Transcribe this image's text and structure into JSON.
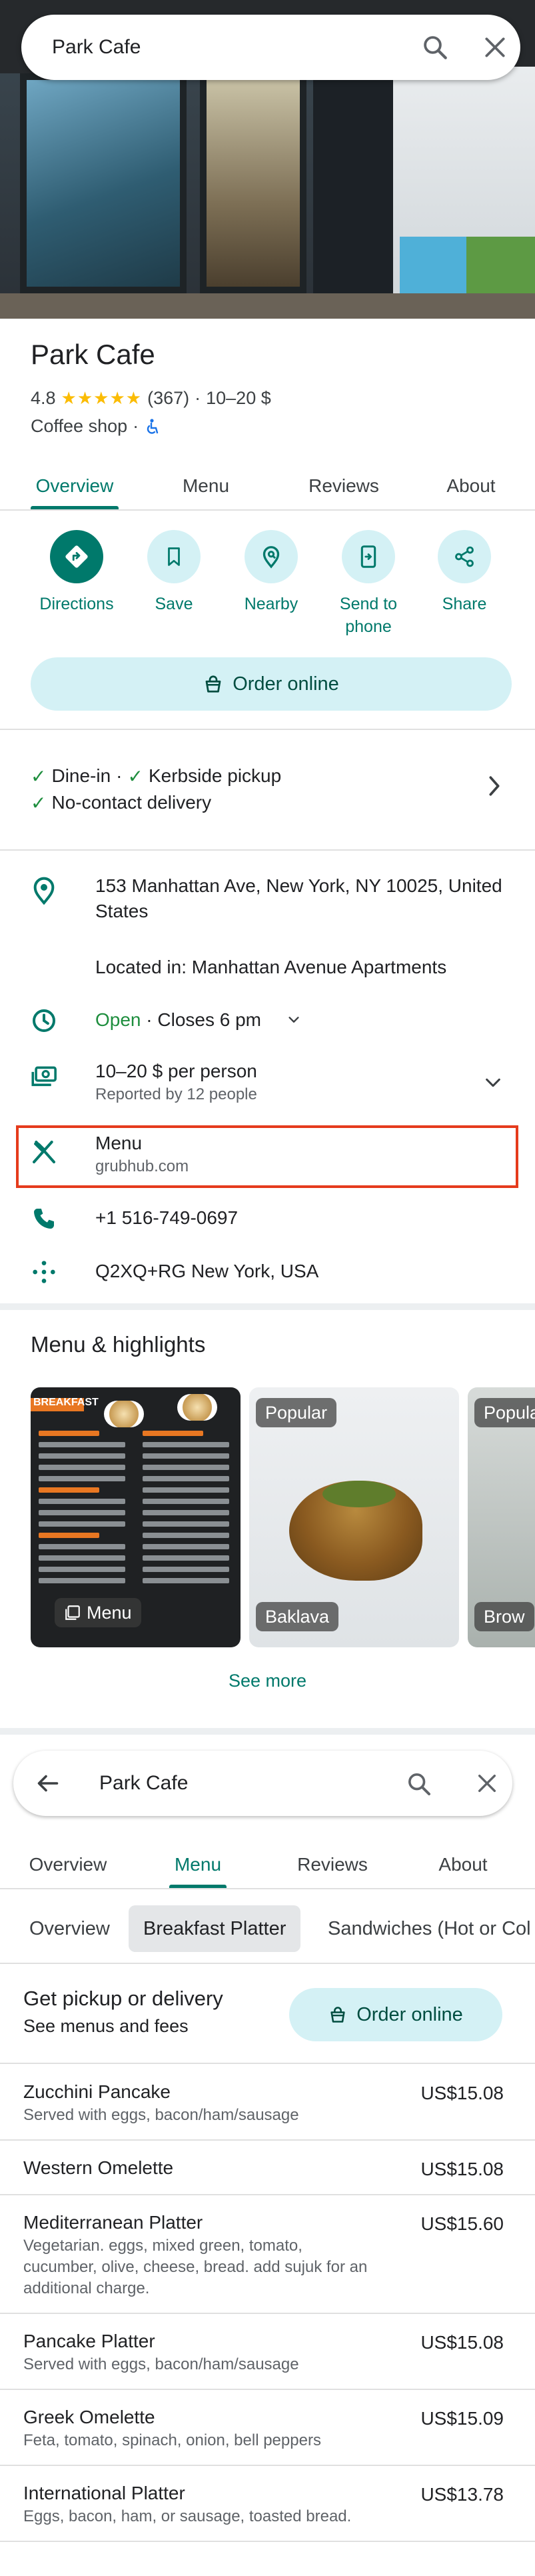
{
  "search": {
    "query": "Park Cafe"
  },
  "place": {
    "name": "Park Cafe",
    "rating": "4.8",
    "stars": "★★★★★",
    "reviews_count": "(367)",
    "price_range": "10–20 $",
    "category": "Coffee shop",
    "separator": "·",
    "price_separator": "·"
  },
  "tabs": [
    "Overview",
    "Menu",
    "Reviews",
    "About"
  ],
  "actions": [
    "Directions",
    "Save",
    "Nearby",
    "Send to phone",
    "Share"
  ],
  "order_online": "Order online",
  "services": {
    "dine_in": "Dine-in",
    "kerbside": "Kerbside pickup",
    "no_contact": "No-contact delivery",
    "dot": "·"
  },
  "info": {
    "address": "153 Manhattan Ave, New York, NY 10025, United States",
    "located_in": "Located in: Manhattan Avenue Apartments",
    "hours_status": "Open",
    "hours_closes": " · Closes 6 pm",
    "price_per_person": "10–20 $ per person",
    "price_reported": "Reported by 12 people",
    "menu_label": "Menu",
    "menu_source": "grubhub.com",
    "phone": "+1 516-749-0697",
    "plus_code": "Q2XQ+RG New York, USA"
  },
  "highlights": {
    "title": "Menu & highlights",
    "cards": [
      "Menu",
      "Popular",
      "Baklava",
      "Popular",
      "Brow"
    ],
    "menu_board": "BREAKFAST",
    "see_more": "See more"
  },
  "panel2": {
    "query": "Park Cafe",
    "tabs": [
      "Overview",
      "Menu",
      "Reviews",
      "About"
    ],
    "subtabs": [
      "Overview",
      "Breakfast Platter",
      "Sandwiches (Hot or Col"
    ],
    "pickup_title": "Get pickup or delivery",
    "pickup_sub": "See menus and fees",
    "order_online": "Order online",
    "items": [
      {
        "name": "Zucchini Pancake",
        "desc": "Served with eggs, bacon/ham/sausage",
        "price": "US$15.08"
      },
      {
        "name": "Western Omelette",
        "desc": "",
        "price": "US$15.08"
      },
      {
        "name": "Mediterranean Platter",
        "desc": "Vegetarian. eggs, mixed green, tomato, cucumber, olive, cheese, bread. add sujuk for an additional charge.",
        "price": "US$15.60"
      },
      {
        "name": "Pancake Platter",
        "desc": "Served with eggs, bacon/ham/sausage",
        "price": "US$15.08"
      },
      {
        "name": "Greek Omelette",
        "desc": "Feta, tomato, spinach, onion, bell peppers",
        "price": "US$15.09"
      },
      {
        "name": "International Platter",
        "desc": "Eggs, bacon, ham, or sausage, toasted bread.",
        "price": "US$13.78"
      }
    ]
  },
  "colors": {
    "accent": "#00796b",
    "chip_bg": "#d4f1f5",
    "open": "#1e8e3e",
    "highlight_border": "#e53b1c",
    "star": "#fbbc04"
  },
  "icons": [
    "search-icon",
    "close-icon",
    "back-arrow-icon",
    "directions-icon",
    "bookmark-icon",
    "nearby-icon",
    "send-to-phone-icon",
    "share-icon",
    "shopping-bag-icon",
    "check-icon",
    "chevron-right-icon",
    "chevron-down-icon",
    "location-pin-icon",
    "clock-icon",
    "money-icon",
    "cutlery-icon",
    "phone-icon",
    "plus-code-icon",
    "wheelchair-icon"
  ]
}
